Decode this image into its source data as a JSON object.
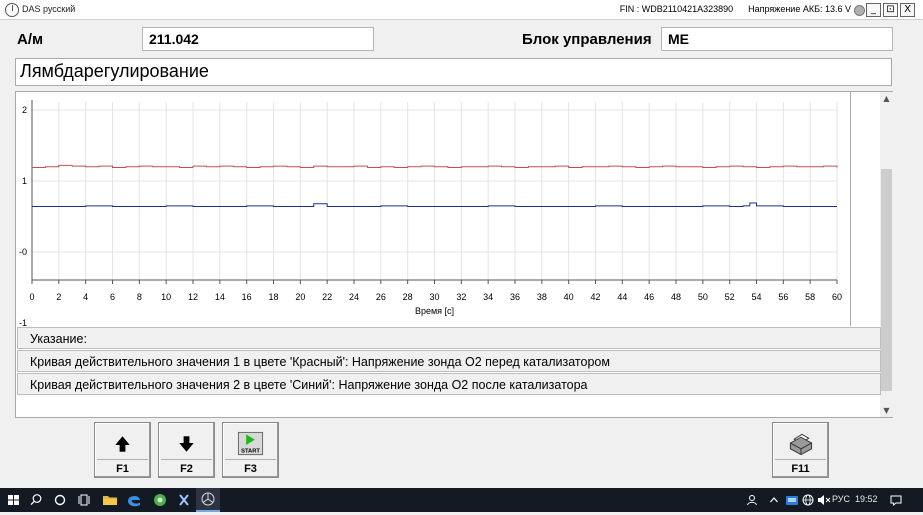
{
  "window": {
    "title": "DAS русский",
    "fin": "FIN : WDB2110421A323890",
    "battery": "Напряжение АКБ: 13.6 V",
    "controls": [
      "_",
      "⊡",
      "X"
    ]
  },
  "header": {
    "model_label": "А/м",
    "model_value": "211.042",
    "ecu_label": "Блок управления",
    "ecu_value": "ME"
  },
  "section_title": "Лямбдарегулирование",
  "chart_data": {
    "type": "line",
    "xlabel": "Время [с]",
    "ylabel": "",
    "xlim": [
      0,
      60
    ],
    "ylim": [
      -1,
      2.2
    ],
    "x_ticks": [
      0,
      2,
      4,
      6,
      8,
      10,
      12,
      14,
      16,
      18,
      20,
      22,
      24,
      26,
      28,
      30,
      32,
      34,
      36,
      38,
      40,
      42,
      44,
      46,
      48,
      50,
      52,
      54,
      56,
      58,
      60
    ],
    "y_ticks": [
      {
        "value": 2,
        "label": "2"
      },
      {
        "value": 1,
        "label": "1"
      },
      {
        "value": 0,
        "label": "-0"
      },
      {
        "value": -1,
        "label": "-1"
      }
    ],
    "grid": true,
    "series": [
      {
        "color": "#c0504d",
        "x": [
          0,
          1,
          2,
          3,
          4,
          5,
          6,
          7,
          8,
          9,
          10,
          11,
          12,
          13,
          14,
          15,
          16,
          17,
          18,
          19,
          20,
          21,
          22,
          23,
          24,
          25,
          26,
          27,
          28,
          29,
          30,
          31,
          32,
          33,
          34,
          35,
          36,
          37,
          38,
          39,
          40,
          41,
          42,
          43,
          44,
          45,
          46,
          47,
          48,
          49,
          50,
          51,
          52,
          53,
          54,
          55,
          56,
          57,
          58,
          59,
          60
        ],
        "y": [
          1.19,
          1.2,
          1.22,
          1.21,
          1.2,
          1.21,
          1.19,
          1.2,
          1.21,
          1.2,
          1.2,
          1.19,
          1.21,
          1.2,
          1.21,
          1.2,
          1.19,
          1.2,
          1.21,
          1.2,
          1.19,
          1.21,
          1.2,
          1.2,
          1.21,
          1.19,
          1.2,
          1.19,
          1.2,
          1.21,
          1.2,
          1.19,
          1.2,
          1.2,
          1.21,
          1.2,
          1.19,
          1.2,
          1.2,
          1.21,
          1.19,
          1.2,
          1.2,
          1.21,
          1.2,
          1.19,
          1.2,
          1.21,
          1.2,
          1.2,
          1.19,
          1.2,
          1.21,
          1.2,
          1.19,
          1.2,
          1.21,
          1.2,
          1.2,
          1.21,
          1.19
        ]
      },
      {
        "color": "#1f2f8f",
        "x": [
          0,
          2,
          4,
          6,
          8,
          10,
          12,
          14,
          16,
          18,
          20,
          21,
          22,
          24,
          26,
          28,
          30,
          32,
          34,
          36,
          38,
          40,
          42,
          44,
          46,
          48,
          50,
          52,
          53,
          53.5,
          54,
          56,
          58,
          60
        ],
        "y": [
          0.64,
          0.64,
          0.65,
          0.64,
          0.64,
          0.65,
          0.64,
          0.64,
          0.65,
          0.64,
          0.64,
          0.68,
          0.64,
          0.64,
          0.65,
          0.64,
          0.64,
          0.64,
          0.65,
          0.64,
          0.64,
          0.64,
          0.65,
          0.64,
          0.64,
          0.64,
          0.65,
          0.64,
          0.65,
          0.69,
          0.65,
          0.64,
          0.64,
          0.64
        ]
      }
    ]
  },
  "notes": {
    "heading": "Указание:",
    "line1": "Кривая действительного значения 1 в цвете 'Красный': Напряжение зонда О2 перед катализатором",
    "line2": "Кривая действительного значения 2 в цвете 'Синий': Напряжение зонда О2 после катализатора"
  },
  "fkeys": [
    {
      "label": "F1",
      "icon": "arrow-up-icon"
    },
    {
      "label": "F2",
      "icon": "arrow-down-icon"
    },
    {
      "label": "F3",
      "icon": "start-icon",
      "icon_text": "START"
    },
    {
      "label": "F11",
      "icon": "printer-icon"
    }
  ],
  "taskbar": {
    "language": "РУС",
    "time": "19:52"
  }
}
